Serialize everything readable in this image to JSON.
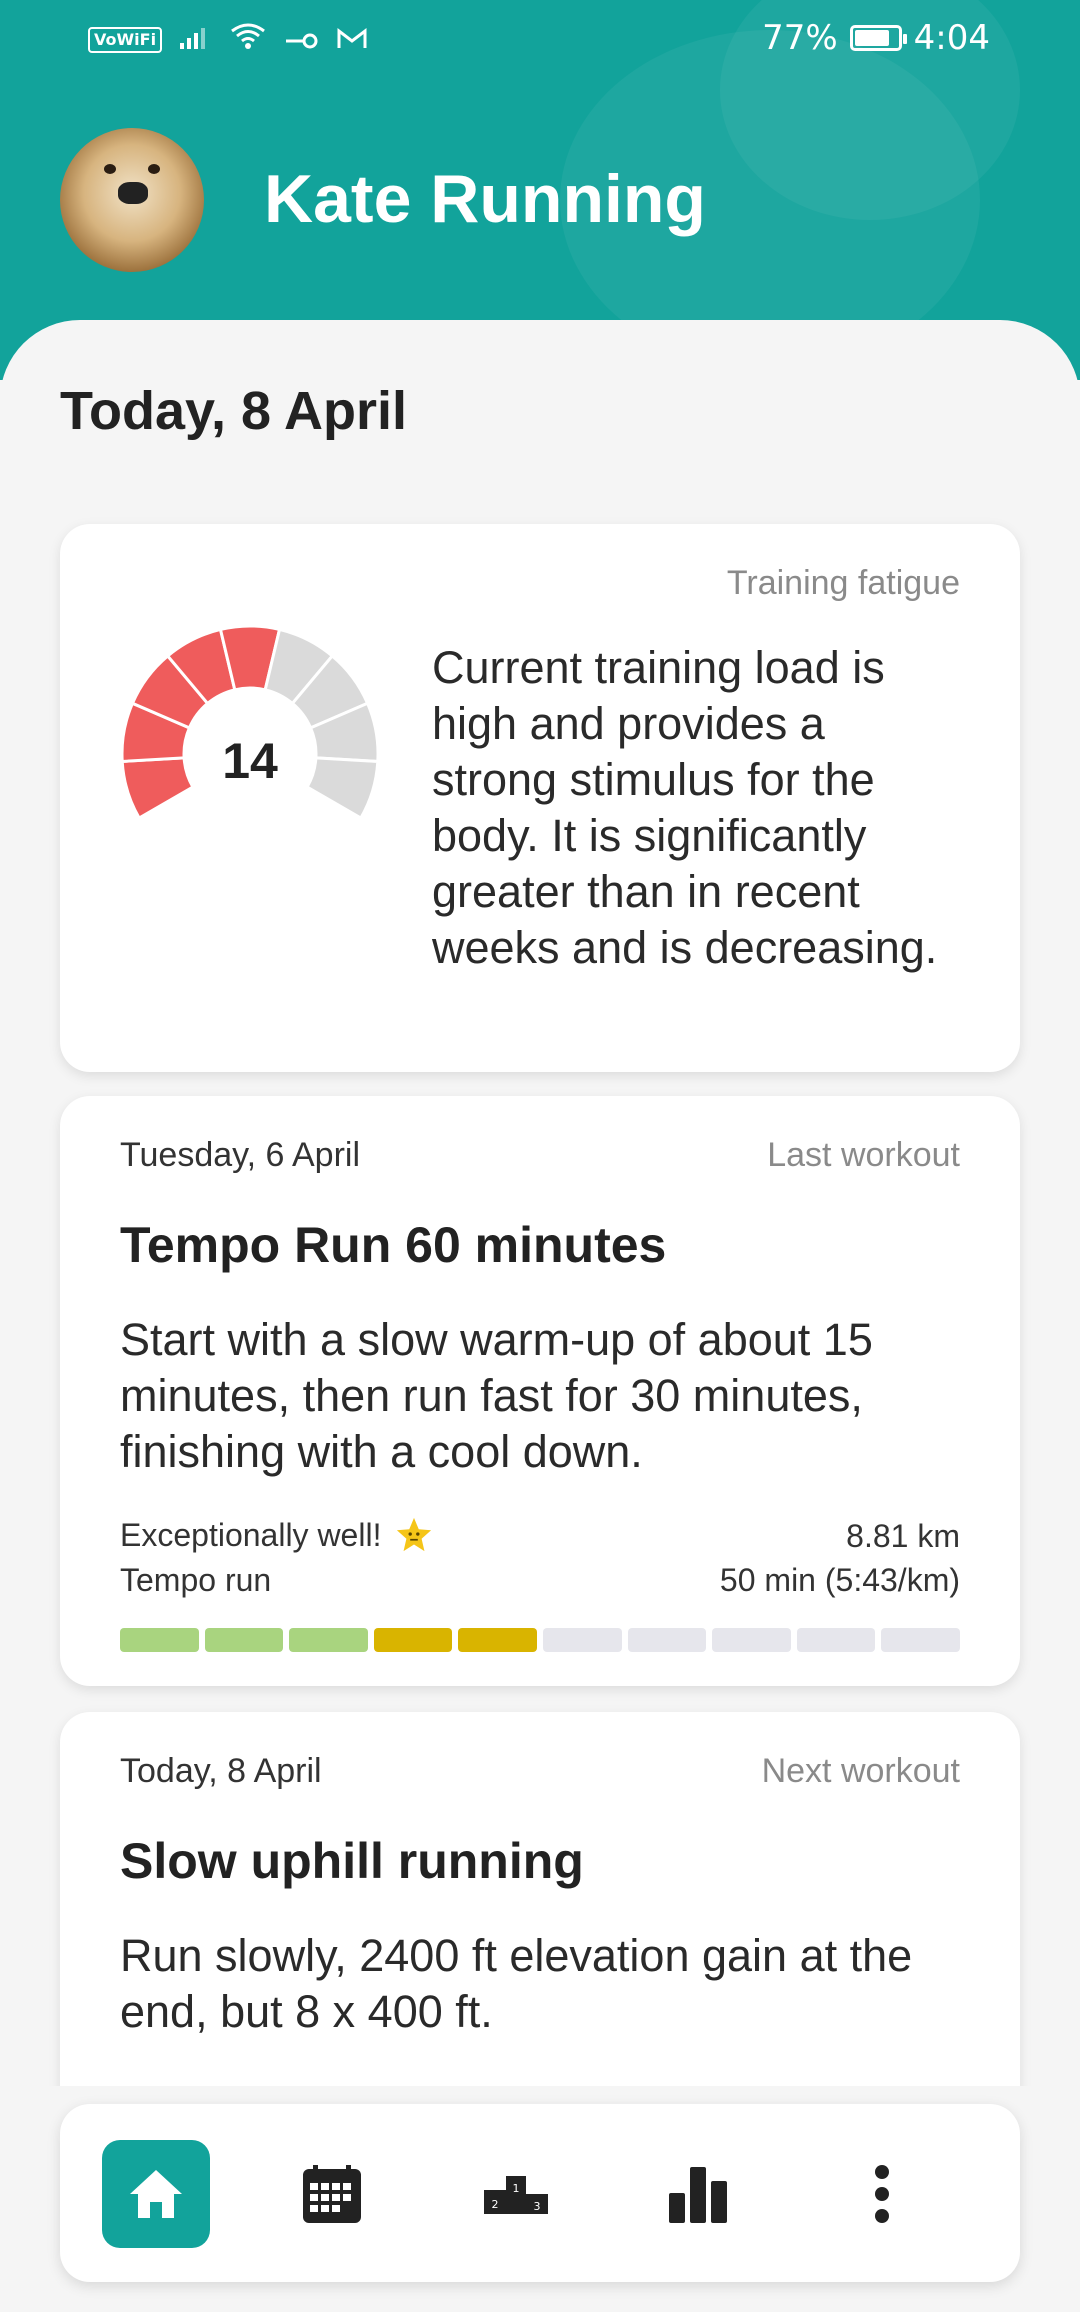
{
  "status_bar": {
    "vowifi": "VoWiFi",
    "battery_percent": "77%",
    "time": "4:04"
  },
  "header": {
    "user_name": "Kate Running"
  },
  "today_title": "Today, 8 April",
  "fatigue_card": {
    "hint": "Training fatigue",
    "value": "14",
    "description": "Current training load is high and provides a strong stimulus for the body. It is significantly greater than in recent weeks and is decreasing.",
    "gauge_filled_segments": 5,
    "gauge_total_segments": 9,
    "colors": {
      "filled": "#ef5c5c",
      "empty": "#dadada"
    }
  },
  "last_workout": {
    "date": "Tuesday, 6 April",
    "hint": "Last workout",
    "title": "Tempo Run 60 minutes",
    "description": "Start with a slow warm-up of about 15 minutes, then run fast for 30 minutes, finishing with a cool down.",
    "rating": "Exceptionally well!",
    "type": "Tempo run",
    "distance": "8.81 km",
    "duration": "50 min (5:43/km)",
    "segments": [
      "green",
      "green",
      "green",
      "yellow",
      "yellow",
      "empty",
      "empty",
      "empty",
      "empty",
      "empty"
    ],
    "colors": {
      "green": "#a9d47f",
      "yellow": "#d9b400",
      "empty": "#e6e6ec"
    }
  },
  "next_workout": {
    "date": "Today, 8 April",
    "hint": "Next workout",
    "title": "Slow uphill running",
    "description": "Run slowly, 2400 ft elevation gain at the end, but 8 x 400 ft."
  },
  "bottom_nav": {
    "items": [
      "home-icon",
      "calendar-icon",
      "podium-icon",
      "bar-chart-icon",
      "more-icon"
    ],
    "active": "home-icon",
    "accent": "#12a39b"
  }
}
